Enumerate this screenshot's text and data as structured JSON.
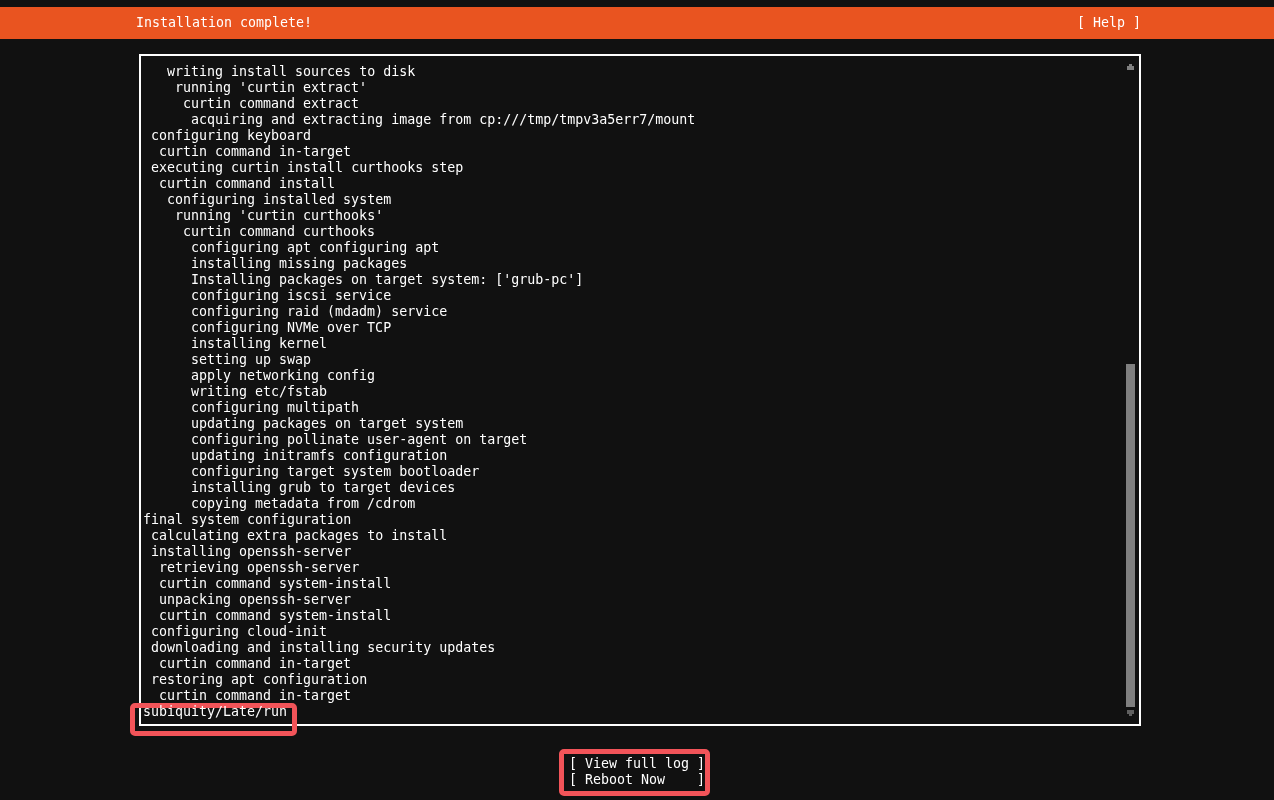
{
  "header": {
    "title": "Installation complete!",
    "help": "[ Help ]"
  },
  "log": {
    "lines": [
      {
        "children": [
          {
            "children": [
              {
                "children": [
                  {
                    "text": "writing install sources to disk",
                    "children": [
                      {
                        "text": "running 'curtin extract'",
                        "children": [
                          {
                            "text": "curtin command extract",
                            "children": [
                              {
                                "text": "acquiring and extracting image from cp:///tmp/tmpv3a5err7/mount"
                              }
                            ]
                          }
                        ]
                      }
                    ]
                  }
                ]
              }
            ]
          },
          {
            "text": "configuring keyboard",
            "children": [
              {
                "text": "curtin command in-target"
              }
            ]
          },
          {
            "text": "executing curtin install curthooks step",
            "children": [
              {
                "text": "curtin command install",
                "children": [
                  {
                    "text": "configuring installed system",
                    "children": [
                      {
                        "text": "running 'curtin curthooks'",
                        "children": [
                          {
                            "text": "curtin command curthooks",
                            "children": [
                              {
                                "text": "configuring apt configuring apt"
                              },
                              {
                                "text": "installing missing packages"
                              },
                              {
                                "text": "Installing packages on target system: ['grub-pc']"
                              },
                              {
                                "text": "configuring iscsi service"
                              },
                              {
                                "text": "configuring raid (mdadm) service"
                              },
                              {
                                "text": "configuring NVMe over TCP"
                              },
                              {
                                "text": "installing kernel"
                              },
                              {
                                "text": "setting up swap"
                              },
                              {
                                "text": "apply networking config"
                              },
                              {
                                "text": "writing etc/fstab"
                              },
                              {
                                "text": "configuring multipath"
                              },
                              {
                                "text": "updating packages on target system"
                              },
                              {
                                "text": "configuring pollinate user-agent on target"
                              },
                              {
                                "text": "updating initramfs configuration"
                              },
                              {
                                "text": "configuring target system bootloader"
                              },
                              {
                                "text": "installing grub to target devices"
                              },
                              {
                                "text": "copying metadata from /cdrom"
                              }
                            ]
                          }
                        ]
                      }
                    ]
                  }
                ]
              }
            ]
          }
        ]
      },
      {
        "text": "final system configuration",
        "children": [
          {
            "text": "calculating extra packages to install"
          },
          {
            "text": "installing openssh-server",
            "children": [
              {
                "text": "retrieving openssh-server"
              },
              {
                "text": "curtin command system-install"
              },
              {
                "text": "unpacking openssh-server"
              },
              {
                "text": "curtin command system-install"
              }
            ]
          },
          {
            "text": "configuring cloud-init"
          },
          {
            "text": "downloading and installing security updates",
            "children": [
              {
                "text": "curtin command in-target"
              }
            ]
          },
          {
            "text": "restoring apt configuration",
            "children": [
              {
                "text": "curtin command in-target"
              }
            ]
          }
        ]
      },
      {
        "text": "subiquity/Late/run",
        "highlighted": true
      }
    ]
  },
  "buttons": {
    "highlighted": true,
    "items": [
      "[ View full log ]",
      "[ Reboot Now    ]"
    ]
  }
}
